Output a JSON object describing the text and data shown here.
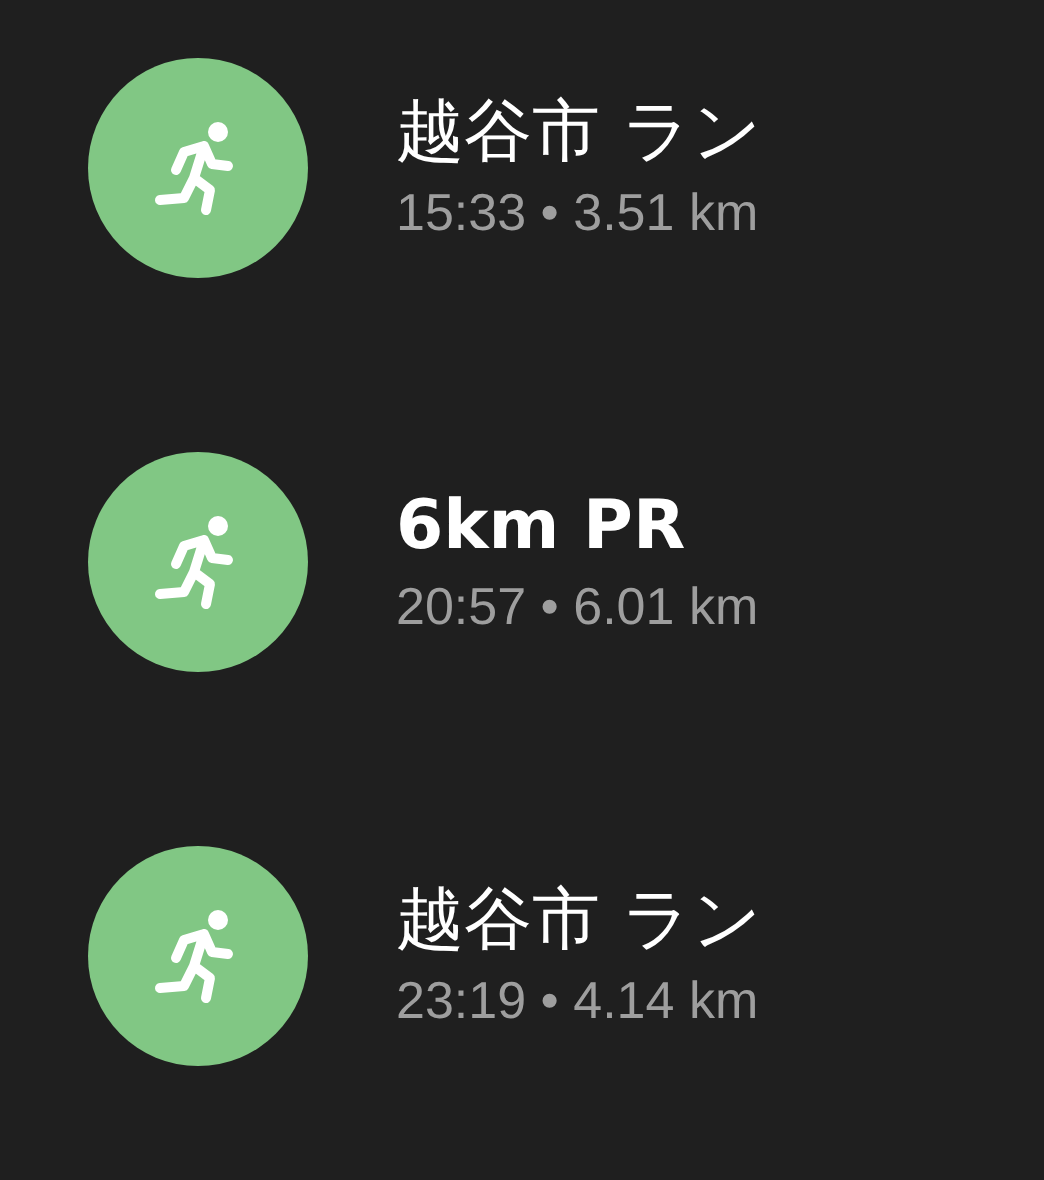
{
  "activities": [
    {
      "title": "越谷市 ラン",
      "bold": false,
      "summary": "15:33 • 3.51 km"
    },
    {
      "title": "6km PR",
      "bold": true,
      "summary": "20:57 • 6.01 km"
    },
    {
      "title": "越谷市 ラン",
      "bold": false,
      "summary": "23:19 • 4.14 km"
    }
  ]
}
